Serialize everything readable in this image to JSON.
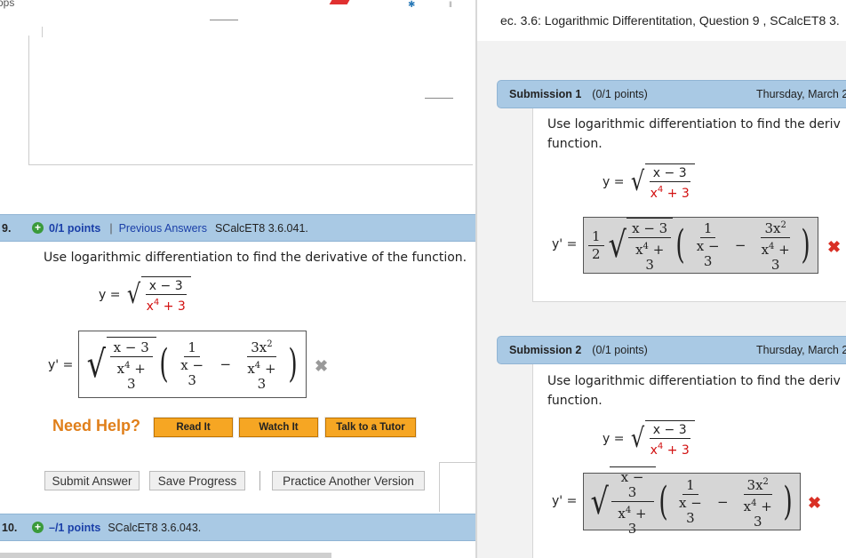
{
  "left": {
    "apps_label": "ops",
    "q9": {
      "num": "9.",
      "points": "0/1 points",
      "separator": "|",
      "prev_answers": "Previous Answers",
      "code": "SCalcET8 3.6.041.",
      "question": "Use logarithmic differentiation to find the derivative of the function.",
      "y_label": "y =",
      "num_expr": "x − 3",
      "den_base": "x",
      "den_exp": "4",
      "den_const": " + 3",
      "yp_label": "y' =",
      "ans_num": "x − 3",
      "ans_den_base": "x",
      "ans_den_exp": "4",
      "ans_den_rest": " + 3",
      "ans_f1_num": "1",
      "ans_f1_den": "x − 3",
      "ans_minus": "−",
      "ans_f2_num_base": "3x",
      "ans_f2_num_exp": "2",
      "ans_f2_den_base": "x",
      "ans_f2_den_exp": "4",
      "ans_f2_den_rest": " + 3",
      "wrong_mark": "✖"
    },
    "help": {
      "need_help": "Need Help?",
      "read_it": "Read It",
      "watch_it": "Watch It",
      "tutor": "Talk to a Tutor"
    },
    "actions": {
      "submit": "Submit Answer",
      "save": "Save Progress",
      "practice": "Practice Another Version"
    },
    "q10": {
      "num": "10.",
      "points": "–/1 points",
      "code": "SCalcET8 3.6.043."
    }
  },
  "right": {
    "title": "ec. 3.6: Logarithmic Differentitation, Question 9 , SCalcET8 3.",
    "submissions": [
      {
        "title": "Submission 1",
        "points": "(0/1 points)",
        "date": "Thursday, March 2",
        "text_line1": "Use logarithmic differentiation to find the deriv",
        "text_line2": "function.",
        "y_label": "y =",
        "num_expr": "x − 3",
        "den_base": "x",
        "den_exp": "4",
        "den_const": " + 3",
        "yp_label": "y' =",
        "coef_num": "1",
        "coef_den": "2",
        "ans_num": "x − 3",
        "ans_den_base": "x",
        "ans_den_exp": "4",
        "ans_den_rest": " + 3",
        "f1_num": "1",
        "f1_den": "x − 3",
        "minus": "−",
        "f2_num_base": "3x",
        "f2_num_exp": "2",
        "f2_den_base": "x",
        "f2_den_exp": "4",
        "f2_den_rest": " + 3",
        "wrong_mark": "✖"
      },
      {
        "title": "Submission 2",
        "points": "(0/1 points)",
        "date": "Thursday, March 2",
        "text_line1": "Use logarithmic differentiation to find the deriv",
        "text_line2": "function.",
        "y_label": "y =",
        "num_expr": "x − 3",
        "den_base": "x",
        "den_exp": "4",
        "den_const": " + 3",
        "yp_label": "y' =",
        "ans_num": "x − 3",
        "ans_den_base": "x",
        "ans_den_exp": "4",
        "ans_den_rest": " + 3",
        "f1_num": "1",
        "f1_den": "x − 3",
        "minus": "−",
        "f2_num_base": "3x",
        "f2_num_exp": "2",
        "f2_den_base": "x",
        "f2_den_exp": "4",
        "f2_den_rest": " + 3",
        "wrong_mark": "✖"
      }
    ]
  },
  "colors": {
    "header_blue": "#a9c9e4",
    "link_blue": "#1a3fa8",
    "help_orange": "#e07f1a",
    "button_orange": "#f6a623",
    "wrong_red": "#d93025",
    "gray_wrong_box": "#d6d6d6"
  }
}
